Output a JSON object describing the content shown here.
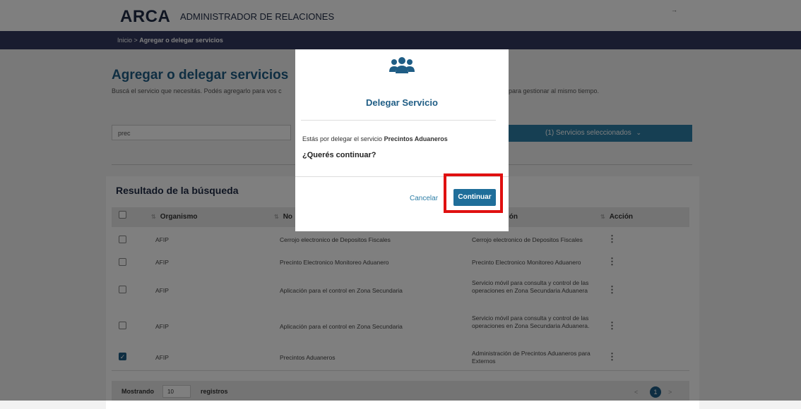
{
  "header": {
    "logo": "ARCA",
    "subtitle": "ADMINISTRADOR DE RELACIONES"
  },
  "breadcrumb": {
    "home": "Inicio",
    "separator": " > ",
    "current": "Agregar o delegar servicios"
  },
  "page": {
    "title": "Agregar o delegar servicios",
    "description_left": "Buscá el servicio que necesitás. Podés agregarlo para vos c",
    "description_right": "para gestionar al mismo tiempo."
  },
  "search": {
    "value": "prec"
  },
  "selected_services": {
    "label": "(1) Servicios seleccionados",
    "chevron": "⌄"
  },
  "results": {
    "title": "Resultado de la búsqueda",
    "headers": [
      "Organismo",
      "No",
      "ión",
      "Acción"
    ],
    "rows": [
      {
        "organismo": "AFIP",
        "nombre": "Cerrojo electronico de Depositos Fiscales",
        "descripcion": "Cerrojo electronico de Depositos Fiscales",
        "checked": false
      },
      {
        "organismo": "AFIP",
        "nombre": "Precinto Electronico Monitoreo Aduanero",
        "descripcion": "Precinto Electronico Monitoreo Aduanero",
        "checked": false
      },
      {
        "organismo": "AFIP",
        "nombre": "Aplicación para el control en Zona Secundaria",
        "descripcion": "Servicio móvil para consulta y control de las operaciones en Zona Secundaria Aduanera",
        "checked": false
      },
      {
        "organismo": "AFIP",
        "nombre": "Aplicación para el control en Zona Secundaria",
        "descripcion": "Servicio móvil para consulta y control de las operaciones en Zona Secundaria Aduanera.",
        "checked": false
      },
      {
        "organismo": "AFIP",
        "nombre": "Precintos Aduaneros",
        "descripcion": "Administración de Precintos Aduaneros para Externos",
        "checked": true
      }
    ]
  },
  "footer": {
    "show_label": "Mostrando",
    "page_size": "10",
    "records_label": "registros",
    "prev": "<",
    "current_page": "1",
    "next": ">"
  },
  "modal": {
    "icon": "users-icon",
    "title": "Delegar Servicio",
    "text_prefix": "Estás por delegar el servicio ",
    "service_name": "Precintos Aduaneros",
    "question": "¿Querés continuar?",
    "cancel_label": "Cancelar",
    "continue_label": "Continuar"
  },
  "colors": {
    "accent": "#1f5d85",
    "navbar": "#33385e",
    "highlight": "#e01010"
  }
}
